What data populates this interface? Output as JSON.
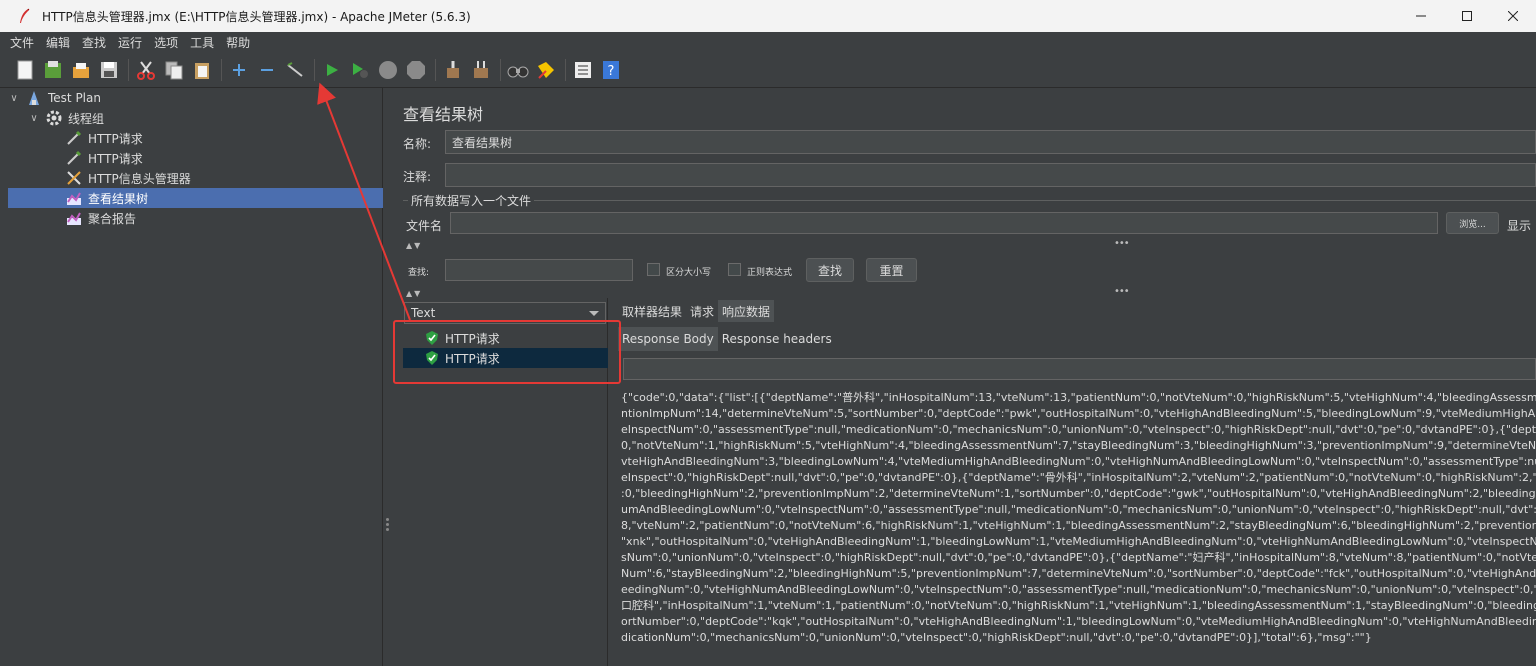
{
  "window": {
    "title": "HTTP信息头管理器.jmx (E:\\HTTP信息头管理器.jmx) - Apache JMeter (5.6.3)",
    "controls": [
      "minimize-icon",
      "maximize-icon",
      "close-icon"
    ]
  },
  "menu": [
    "文件",
    "编辑",
    "查找",
    "运行",
    "选项",
    "工具",
    "帮助"
  ],
  "toolbar": {
    "icons": [
      "new-icon",
      "templates-icon",
      "open-icon",
      "save-icon",
      "cut-icon",
      "copy-icon",
      "paste-icon",
      "expand-icon",
      "collapse-icon",
      "toggle-icon",
      "start-icon",
      "start-no-pauses-icon",
      "stop-icon",
      "shutdown-icon",
      "clear-icon",
      "clear-all-icon",
      "search-icon",
      "reset-search-icon",
      "function-helper-icon",
      "help-icon"
    ]
  },
  "tree": {
    "items": [
      {
        "label": "Test Plan",
        "icon": "test-plan-icon"
      },
      {
        "label": "线程组",
        "icon": "gear-icon"
      },
      {
        "label": "HTTP请求",
        "icon": "pipette-icon"
      },
      {
        "label": "HTTP请求",
        "icon": "pipette-icon"
      },
      {
        "label": "HTTP信息头管理器",
        "icon": "tools-icon"
      },
      {
        "label": "查看结果树",
        "icon": "chart-icon",
        "selected": true
      },
      {
        "label": "聚合报告",
        "icon": "chart-icon"
      }
    ]
  },
  "panel": {
    "title": "查看结果树",
    "name_label": "名称:",
    "name_value": "查看结果树",
    "comment_label": "注释:",
    "comment_value": "",
    "fieldset_legend": "所有数据写入一个文件",
    "filename_label": "文件名",
    "filename_value": "",
    "browse_label": "浏览...",
    "display_label": "显示",
    "search_label": "查找:",
    "search_value": "",
    "case_label": "区分大小写",
    "regex_label": "正则表达式",
    "find_button": "查找",
    "reset_button": "重置",
    "renderer": "Text"
  },
  "results": {
    "samples": [
      "HTTP请求",
      "HTTP请求"
    ],
    "tabs": [
      "取样器结果",
      "请求",
      "响应数据"
    ],
    "active_tab": "响应数据",
    "subtabs": [
      "Response Body",
      "Response headers"
    ],
    "active_subtab": "Response Body",
    "body_lines": [
      "{\"code\":0,\"data\":{\"list\":[{\"deptName\":\"普外科\",\"inHospitalNum\":13,\"vteNum\":13,\"patientNum\":0,\"notVteNum\":0,\"highRiskNum\":5,\"vteHighNum\":4,\"bleedingAssessmentNu",
      "ntionImpNum\":14,\"determineVteNum\":5,\"sortNumber\":0,\"deptCode\":\"pwk\",\"outHospitalNum\":0,\"vteHighAndBleedingNum\":5,\"bleedingLowNum\":9,\"vteMediumHighAnd",
      "eInspectNum\":0,\"assessmentType\":null,\"medicationNum\":0,\"mechanicsNum\":0,\"unionNum\":0,\"vteInspect\":0,\"highRiskDept\":null,\"dvt\":0,\"pe\":0,\"dvtandPE\":0},{\"deptName\":",
      "0,\"notVteNum\":1,\"highRiskNum\":5,\"vteHighNum\":4,\"bleedingAssessmentNum\":7,\"stayBleedingNum\":3,\"bleedingHighNum\":3,\"preventionImpNum\":9,\"determineVteNum\"",
      "vteHighAndBleedingNum\":3,\"bleedingLowNum\":4,\"vteMediumHighAndBleedingNum\":0,\"vteHighNumAndBleedingLowNum\":0,\"vteInspectNum\":0,\"assessmentType\":null,",
      "eInspect\":0,\"highRiskDept\":null,\"dvt\":0,\"pe\":0,\"dvtandPE\":0},{\"deptName\":\"骨外科\",\"inHospitalNum\":2,\"vteNum\":2,\"patientNum\":0,\"notVteNum\":0,\"highRiskNum\":2,\"vteHi",
      ":0,\"bleedingHighNum\":2,\"preventionImpNum\":2,\"determineVteNum\":1,\"sortNumber\":0,\"deptCode\":\"gwk\",\"outHospitalNum\":0,\"vteHighAndBleedingNum\":2,\"bleedingLo",
      "umAndBleedingLowNum\":0,\"vteInspectNum\":0,\"assessmentType\":null,\"medicationNum\":0,\"mechanicsNum\":0,\"unionNum\":0,\"vteInspect\":0,\"highRiskDept\":null,\"dvt\":0,\"pe",
      "8,\"vteNum\":2,\"patientNum\":0,\"notVteNum\":6,\"highRiskNum\":1,\"vteHighNum\":1,\"bleedingAssessmentNum\":2,\"stayBleedingNum\":6,\"bleedingHighNum\":2,\"preventionImp",
      "\"xnk\",\"outHospitalNum\":0,\"vteHighAndBleedingNum\":1,\"bleedingLowNum\":1,\"vteMediumHighAndBleedingNum\":0,\"vteHighNumAndBleedingLowNum\":0,\"vteInspectNu",
      "sNum\":0,\"unionNum\":0,\"vteInspect\":0,\"highRiskDept\":null,\"dvt\":0,\"pe\":0,\"dvtandPE\":0},{\"deptName\":\"妇产科\",\"inHospitalNum\":8,\"vteNum\":8,\"patientNum\":0,\"notVteNum\":",
      "Num\":6,\"stayBleedingNum\":2,\"bleedingHighNum\":5,\"preventionImpNum\":7,\"determineVteNum\":0,\"sortNumber\":0,\"deptCode\":\"fck\",\"outHospitalNum\":0,\"vteHighAndBle",
      "eedingNum\":0,\"vteHighNumAndBleedingLowNum\":0,\"vteInspectNum\":0,\"assessmentType\":null,\"medicationNum\":0,\"mechanicsNum\":0,\"unionNum\":0,\"vteInspect\":0,\"hig",
      "口腔科\",\"inHospitalNum\":1,\"vteNum\":1,\"patientNum\":0,\"notVteNum\":0,\"highRiskNum\":1,\"vteHighNum\":1,\"bleedingAssessmentNum\":1,\"stayBleedingNum\":0,\"bleedingHig",
      "ortNumber\":0,\"deptCode\":\"kqk\",\"outHospitalNum\":0,\"vteHighAndBleedingNum\":1,\"bleedingLowNum\":0,\"vteMediumHighAndBleedingNum\":0,\"vteHighNumAndBleeding",
      "dicationNum\":0,\"mechanicsNum\":0,\"unionNum\":0,\"vteInspect\":0,\"highRiskDept\":null,\"dvt\":0,\"pe\":0,\"dvtandPE\":0}],\"total\":6},\"msg\":\"\"}"
    ]
  },
  "colors": {
    "background": "#3c3f41",
    "selection": "#4b6eaf",
    "annotation": "#e53935"
  }
}
